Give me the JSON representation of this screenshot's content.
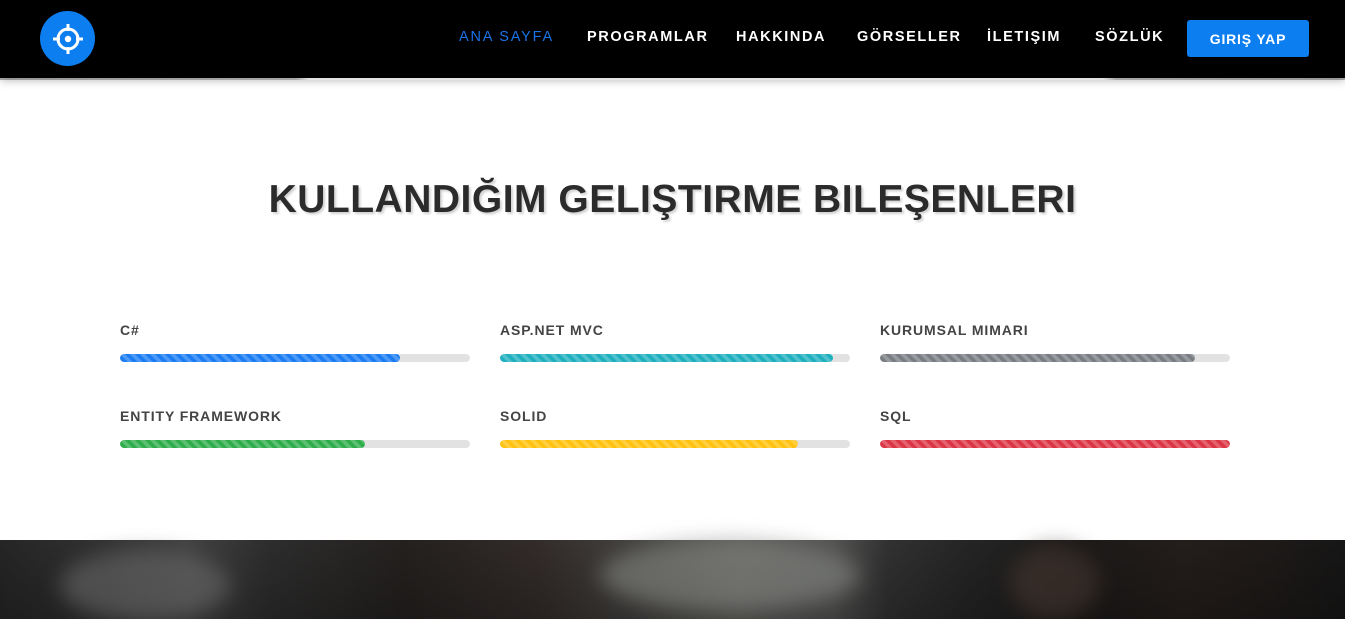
{
  "nav": {
    "items": [
      {
        "label": "ANA SAYFA",
        "active": true
      },
      {
        "label": "PROGRAMLAR",
        "active": false
      },
      {
        "label": "HAKKINDA",
        "active": false
      },
      {
        "label": "GÖRSELLER",
        "active": false
      },
      {
        "label": "İLETIŞIM",
        "active": false
      },
      {
        "label": "SÖZLÜK",
        "active": false
      }
    ],
    "login_label": "GIRIŞ YAP",
    "logo_icon": "crosshair-icon"
  },
  "skills": {
    "title": "KULLANDIĞIM GELIŞTIRME BILEŞENLERI",
    "items": [
      {
        "label": "C#",
        "percent": 80,
        "color": "#1a7ef2"
      },
      {
        "label": "ASP.NET MVC",
        "percent": 95,
        "color": "#1fb0bf"
      },
      {
        "label": "KURUMSAL MIMARI",
        "percent": 90,
        "color": "#7a7e83"
      },
      {
        "label": "ENTITY FRAMEWORK",
        "percent": 70,
        "color": "#2ead4b"
      },
      {
        "label": "SOLID",
        "percent": 85,
        "color": "#ffc20e"
      },
      {
        "label": "SQL",
        "percent": 100,
        "color": "#dc3545"
      }
    ]
  },
  "colors": {
    "accent": "#0d7ef0",
    "navbar_bg": "#000000",
    "active_link": "#1a73e8"
  }
}
